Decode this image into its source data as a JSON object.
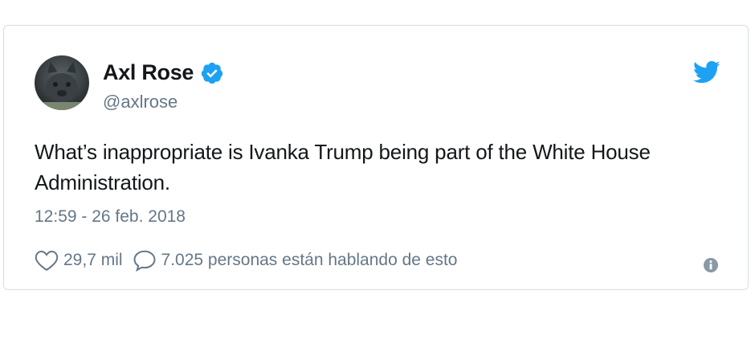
{
  "tweet": {
    "author_name": "Axl Rose",
    "handle": "@axlrose",
    "text": "What’s inappropriate is Ivanka Trump being part of the White House Administration.",
    "timestamp": "12:59 - 26 feb. 2018",
    "likes": "29,7 mil",
    "conversation": "7.025 personas están hablando de esto"
  },
  "colors": {
    "twitter_blue": "#1da1f2",
    "text_primary": "#14171a",
    "text_secondary": "#657786",
    "border": "#d4dee6"
  },
  "icons": {
    "verified": "verified-badge-icon",
    "logo": "twitter-bird-icon",
    "like": "heart-icon",
    "reply": "speech-bubble-icon",
    "info": "info-icon"
  }
}
